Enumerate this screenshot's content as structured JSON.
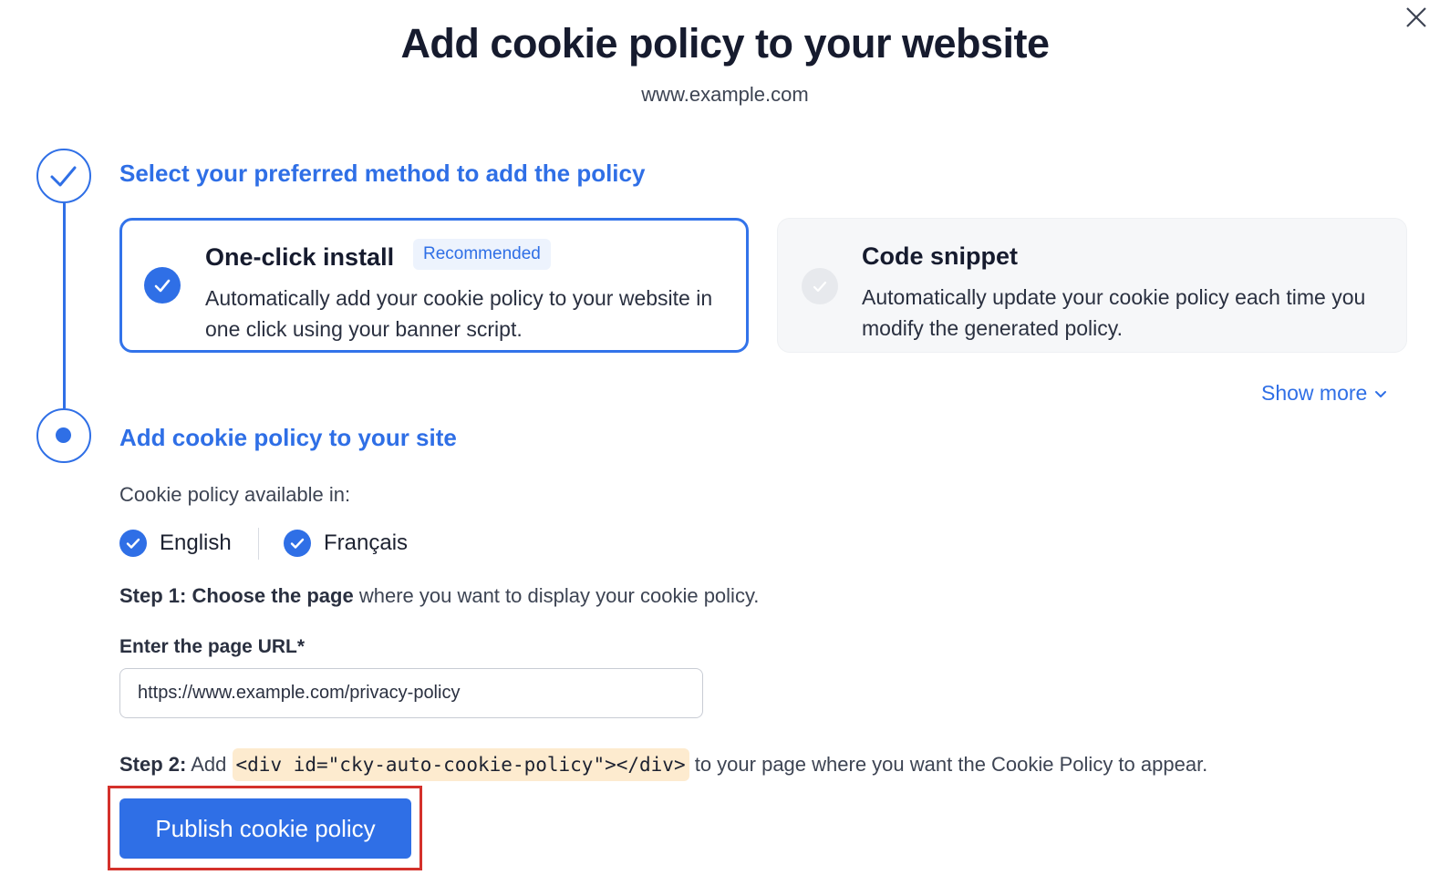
{
  "dialog": {
    "title": "Add cookie policy to your website",
    "subtitle": "www.example.com",
    "close_icon": "close-icon"
  },
  "step1": {
    "title": "Select your preferred method to add the policy",
    "options": [
      {
        "title": "One-click install",
        "badge": "Recommended",
        "description": "Automatically add your cookie policy to your website in one click using your banner script.",
        "selected": true
      },
      {
        "title": "Code snippet",
        "description": "Automatically update your cookie policy each time you modify the generated policy.",
        "selected": false
      }
    ],
    "show_more": "Show more"
  },
  "step2": {
    "title": "Add cookie policy to your site",
    "available_label": "Cookie policy available in:",
    "languages": [
      "English",
      "Français"
    ],
    "step1_bold": "Step 1: Choose the page",
    "step1_rest": " where you want to display your cookie policy.",
    "url_label": "Enter the page URL*",
    "url_value": "https://www.example.com/privacy-policy",
    "step2_bold": "Step 2:",
    "step2_pre": " Add ",
    "step2_code": "<div id=\"cky-auto-cookie-policy\"></div>",
    "step2_post": " to your page where you want the Cookie Policy to appear.",
    "publish_label": "Publish cookie policy"
  },
  "colors": {
    "accent": "#2f6fe6",
    "highlight_outline": "#d4312b",
    "code_bg": "#fdebcf"
  }
}
